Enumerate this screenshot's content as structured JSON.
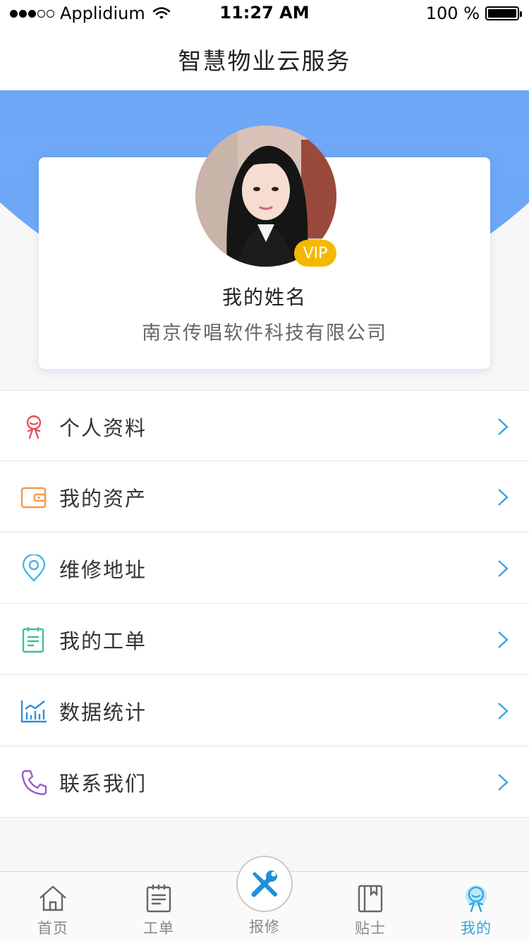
{
  "status_bar": {
    "carrier": "Applidium",
    "time": "11:27 AM",
    "battery": "100 %"
  },
  "nav": {
    "title": "智慧物业云服务"
  },
  "profile": {
    "name": "我的姓名",
    "company": "南京传唱软件科技有限公司",
    "badge": "VIP"
  },
  "menu": {
    "items": [
      {
        "label": "个人资料",
        "icon": "person-icon",
        "color": "#e8515a"
      },
      {
        "label": "我的资产",
        "icon": "wallet-icon",
        "color": "#f39a4b"
      },
      {
        "label": "维修地址",
        "icon": "location-pin-icon",
        "color": "#4ab3e8"
      },
      {
        "label": "我的工单",
        "icon": "clipboard-icon",
        "color": "#3cc48a"
      },
      {
        "label": "数据统计",
        "icon": "bar-chart-icon",
        "color": "#2f8fdc"
      },
      {
        "label": "联系我们",
        "icon": "phone-icon",
        "color": "#9b59d0"
      }
    ]
  },
  "tab_bar": {
    "tabs": [
      {
        "label": "首页",
        "icon": "home-icon"
      },
      {
        "label": "工单",
        "icon": "clipboard-icon"
      },
      {
        "label": "报修",
        "icon": "tools-icon"
      },
      {
        "label": "贴士",
        "icon": "book-icon"
      },
      {
        "label": "我的",
        "icon": "person-icon"
      }
    ],
    "active_index": 4,
    "accent_color": "#2ea7e0"
  }
}
